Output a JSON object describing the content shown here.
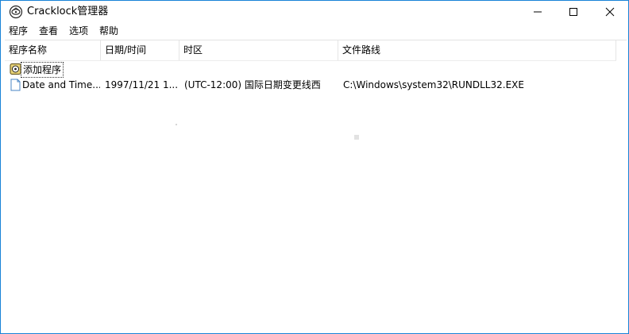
{
  "window": {
    "title": "Cracklock管理器",
    "accent_color": "#1883d7"
  },
  "title_buttons": {
    "minimize_icon": "minimize-icon",
    "maximize_icon": "maximize-icon",
    "close_icon": "close-icon"
  },
  "menu": {
    "items": [
      "程序",
      "查看",
      "选项",
      "帮助"
    ]
  },
  "list": {
    "columns": [
      "程序名称",
      "日期/时间",
      "时区",
      "文件路线"
    ],
    "add_item_label": "添加程序",
    "rows": [
      {
        "name": "Date and Time...",
        "datetime": "1997/11/21 1...",
        "timezone": "(UTC-12:00) 国际日期变更线西",
        "path": "C:\\Windows\\system32\\RUNDLL32.EXE"
      }
    ]
  }
}
